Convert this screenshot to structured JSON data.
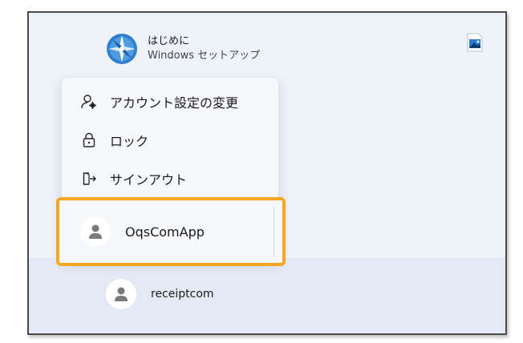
{
  "app": {
    "title": "はじめに",
    "subtitle": "Windows セットアップ",
    "icon": "windows-setup-compass-icon"
  },
  "pinned": {
    "icon": "image-file-icon"
  },
  "menu": {
    "items": [
      {
        "label": "アカウント設定の変更",
        "icon": "account-settings-icon"
      },
      {
        "label": "ロック",
        "icon": "lock-icon"
      },
      {
        "label": "サインアウト",
        "icon": "sign-out-icon"
      }
    ]
  },
  "current_user": {
    "name": "OqsComApp",
    "icon": "person-avatar-icon"
  },
  "other_user": {
    "name": "receiptcom",
    "icon": "person-avatar-icon"
  },
  "colors": {
    "highlight": "#f5a623",
    "accent": "#2b7bd4"
  }
}
